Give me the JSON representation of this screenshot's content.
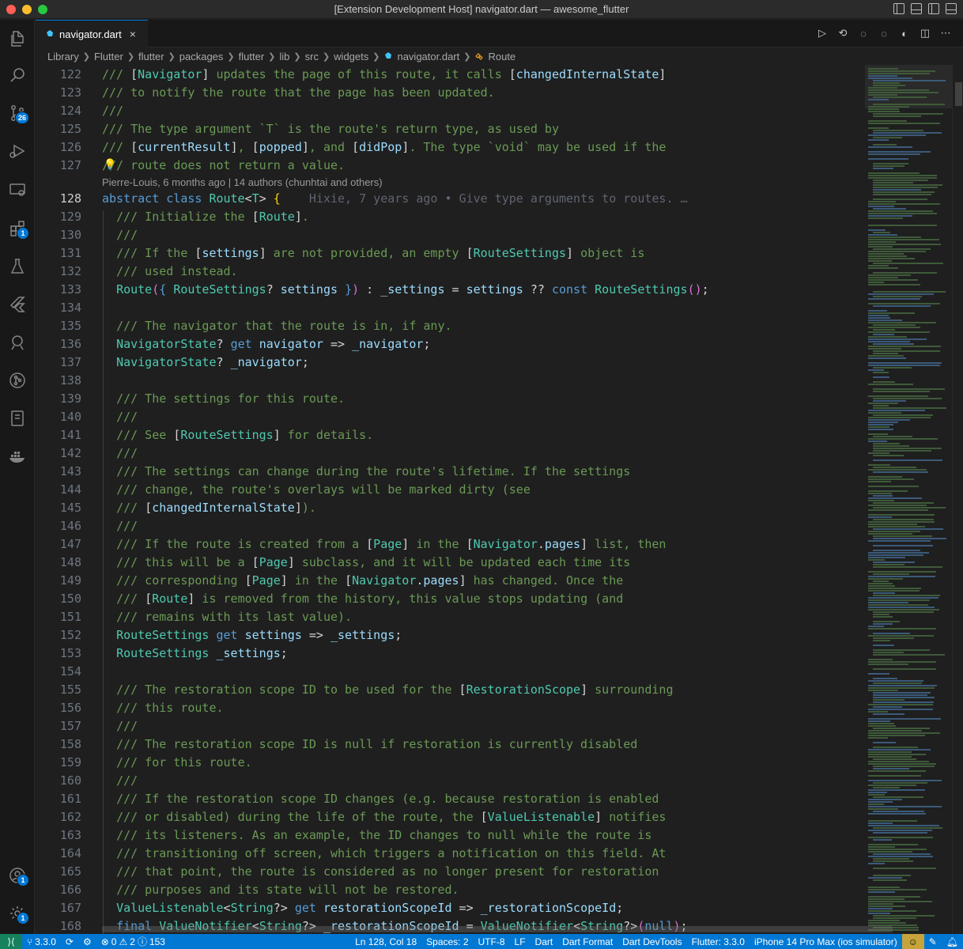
{
  "window": {
    "title": "[Extension Development Host] navigator.dart — awesome_flutter"
  },
  "activity_bar": {
    "source_control_badge": "26",
    "extensions_badge": "1",
    "accounts_badge": "1",
    "settings_badge": "1"
  },
  "tabs": [
    {
      "label": "navigator.dart",
      "close": "×"
    }
  ],
  "breadcrumbs": [
    "Library",
    "Flutter",
    "flutter",
    "packages",
    "flutter",
    "lib",
    "src",
    "widgets",
    "navigator.dart",
    "Route"
  ],
  "editor": {
    "codelens": "Pierre-Louis, 6 months ago | 14 authors (chunhtai and others)",
    "blame": "Hixie, 7 years ago • Give type arguments to routes. …",
    "line_numbers": [
      "122",
      "123",
      "124",
      "125",
      "126",
      "127",
      "128",
      "129",
      "130",
      "131",
      "132",
      "133",
      "134",
      "135",
      "136",
      "137",
      "138",
      "139",
      "140",
      "141",
      "142",
      "143",
      "144",
      "145",
      "146",
      "147",
      "148",
      "149",
      "150",
      "151",
      "152",
      "153",
      "154",
      "155",
      "156",
      "157",
      "158",
      "159",
      "160",
      "161",
      "162",
      "163",
      "164",
      "165",
      "166",
      "167",
      "168"
    ],
    "active_line": "128",
    "lines": [
      [
        [
          "c-cm",
          "/// "
        ],
        [
          "c-pun",
          "["
        ],
        [
          "c-ref",
          "Navigator"
        ],
        [
          "c-pun",
          "]"
        ],
        [
          "c-cm",
          " updates the page of this route, it calls "
        ],
        [
          "c-pun",
          "["
        ],
        [
          "c-refv",
          "changedInternalState"
        ],
        [
          "c-pun",
          "]"
        ]
      ],
      [
        [
          "c-cm",
          "/// to notify the route that the page has been updated."
        ]
      ],
      [
        [
          "c-cm",
          "///"
        ]
      ],
      [
        [
          "c-cm",
          "/// The type argument `T` is the route's return type, as used by"
        ]
      ],
      [
        [
          "c-cm",
          "/// "
        ],
        [
          "c-pun",
          "["
        ],
        [
          "c-refv",
          "currentResult"
        ],
        [
          "c-pun",
          "]"
        ],
        [
          "c-cm",
          ", "
        ],
        [
          "c-pun",
          "["
        ],
        [
          "c-refv",
          "popped"
        ],
        [
          "c-pun",
          "]"
        ],
        [
          "c-cm",
          ", and "
        ],
        [
          "c-pun",
          "["
        ],
        [
          "c-refv",
          "didPop"
        ],
        [
          "c-pun",
          "]"
        ],
        [
          "c-cm",
          ". The type `void` may be used if the"
        ]
      ],
      [
        [
          "c-cm",
          "/// route does not return a value."
        ]
      ],
      [
        [
          "c-kw",
          "abstract"
        ],
        [
          "c-code",
          " "
        ],
        [
          "c-kw",
          "class"
        ],
        [
          "c-code",
          " "
        ],
        [
          "c-ty",
          "Route"
        ],
        [
          "c-pun",
          "<"
        ],
        [
          "c-ty",
          "T"
        ],
        [
          "c-pun",
          "> "
        ],
        [
          "c-br",
          "{"
        ]
      ],
      [
        [
          "c-code",
          "  "
        ],
        [
          "c-cm",
          "/// Initialize the "
        ],
        [
          "c-pun",
          "["
        ],
        [
          "c-ref",
          "Route"
        ],
        [
          "c-pun",
          "]"
        ],
        [
          "c-cm",
          "."
        ]
      ],
      [
        [
          "c-code",
          "  "
        ],
        [
          "c-cm",
          "///"
        ]
      ],
      [
        [
          "c-code",
          "  "
        ],
        [
          "c-cm",
          "/// If the "
        ],
        [
          "c-pun",
          "["
        ],
        [
          "c-refv",
          "settings"
        ],
        [
          "c-pun",
          "]"
        ],
        [
          "c-cm",
          " are not provided, an empty "
        ],
        [
          "c-pun",
          "["
        ],
        [
          "c-ref",
          "RouteSettings"
        ],
        [
          "c-pun",
          "]"
        ],
        [
          "c-cm",
          " object is"
        ]
      ],
      [
        [
          "c-code",
          "  "
        ],
        [
          "c-cm",
          "/// used instead."
        ]
      ],
      [
        [
          "c-code",
          "  "
        ],
        [
          "c-ty",
          "Route"
        ],
        [
          "c-br2",
          "("
        ],
        [
          "c-kw",
          "{"
        ],
        [
          "c-code",
          " "
        ],
        [
          "c-ty",
          "RouteSettings"
        ],
        [
          "c-pun",
          "? "
        ],
        [
          "c-var",
          "settings"
        ],
        [
          "c-code",
          " "
        ],
        [
          "c-kw",
          "}"
        ],
        [
          "c-br2",
          ")"
        ],
        [
          "c-pun",
          " : "
        ],
        [
          "c-var",
          "_settings"
        ],
        [
          "c-pun",
          " = "
        ],
        [
          "c-var",
          "settings"
        ],
        [
          "c-pun",
          " ?? "
        ],
        [
          "c-kw",
          "const"
        ],
        [
          "c-code",
          " "
        ],
        [
          "c-ty",
          "RouteSettings"
        ],
        [
          "c-br2",
          "()"
        ],
        [
          "c-pun",
          ";"
        ]
      ],
      [
        [
          "c-code",
          ""
        ]
      ],
      [
        [
          "c-code",
          "  "
        ],
        [
          "c-cm",
          "/// The navigator that the route is in, if any."
        ]
      ],
      [
        [
          "c-code",
          "  "
        ],
        [
          "c-ty",
          "NavigatorState"
        ],
        [
          "c-pun",
          "? "
        ],
        [
          "c-kw",
          "get"
        ],
        [
          "c-code",
          " "
        ],
        [
          "c-var",
          "navigator"
        ],
        [
          "c-pun",
          " => "
        ],
        [
          "c-var",
          "_navigator"
        ],
        [
          "c-pun",
          ";"
        ]
      ],
      [
        [
          "c-code",
          "  "
        ],
        [
          "c-ty",
          "NavigatorState"
        ],
        [
          "c-pun",
          "? "
        ],
        [
          "c-var",
          "_navigator"
        ],
        [
          "c-pun",
          ";"
        ]
      ],
      [
        [
          "c-code",
          ""
        ]
      ],
      [
        [
          "c-code",
          "  "
        ],
        [
          "c-cm",
          "/// The settings for this route."
        ]
      ],
      [
        [
          "c-code",
          "  "
        ],
        [
          "c-cm",
          "///"
        ]
      ],
      [
        [
          "c-code",
          "  "
        ],
        [
          "c-cm",
          "/// See "
        ],
        [
          "c-pun",
          "["
        ],
        [
          "c-ref",
          "RouteSettings"
        ],
        [
          "c-pun",
          "]"
        ],
        [
          "c-cm",
          " for details."
        ]
      ],
      [
        [
          "c-code",
          "  "
        ],
        [
          "c-cm",
          "///"
        ]
      ],
      [
        [
          "c-code",
          "  "
        ],
        [
          "c-cm",
          "/// The settings can change during the route's lifetime. If the settings"
        ]
      ],
      [
        [
          "c-code",
          "  "
        ],
        [
          "c-cm",
          "/// change, the route's overlays will be marked dirty (see"
        ]
      ],
      [
        [
          "c-code",
          "  "
        ],
        [
          "c-cm",
          "/// "
        ],
        [
          "c-pun",
          "["
        ],
        [
          "c-refv",
          "changedInternalState"
        ],
        [
          "c-pun",
          "]"
        ],
        [
          "c-cm",
          ")."
        ]
      ],
      [
        [
          "c-code",
          "  "
        ],
        [
          "c-cm",
          "///"
        ]
      ],
      [
        [
          "c-code",
          "  "
        ],
        [
          "c-cm",
          "/// If the route is created from a "
        ],
        [
          "c-pun",
          "["
        ],
        [
          "c-ref",
          "Page"
        ],
        [
          "c-pun",
          "]"
        ],
        [
          "c-cm",
          " in the "
        ],
        [
          "c-pun",
          "["
        ],
        [
          "c-ref",
          "Navigator"
        ],
        [
          "c-pun",
          "."
        ],
        [
          "c-refv",
          "pages"
        ],
        [
          "c-pun",
          "]"
        ],
        [
          "c-cm",
          " list, then"
        ]
      ],
      [
        [
          "c-code",
          "  "
        ],
        [
          "c-cm",
          "/// this will be a "
        ],
        [
          "c-pun",
          "["
        ],
        [
          "c-ref",
          "Page"
        ],
        [
          "c-pun",
          "]"
        ],
        [
          "c-cm",
          " subclass, and it will be updated each time its"
        ]
      ],
      [
        [
          "c-code",
          "  "
        ],
        [
          "c-cm",
          "/// corresponding "
        ],
        [
          "c-pun",
          "["
        ],
        [
          "c-ref",
          "Page"
        ],
        [
          "c-pun",
          "]"
        ],
        [
          "c-cm",
          " in the "
        ],
        [
          "c-pun",
          "["
        ],
        [
          "c-ref",
          "Navigator"
        ],
        [
          "c-pun",
          "."
        ],
        [
          "c-refv",
          "pages"
        ],
        [
          "c-pun",
          "]"
        ],
        [
          "c-cm",
          " has changed. Once the"
        ]
      ],
      [
        [
          "c-code",
          "  "
        ],
        [
          "c-cm",
          "/// "
        ],
        [
          "c-pun",
          "["
        ],
        [
          "c-ref",
          "Route"
        ],
        [
          "c-pun",
          "]"
        ],
        [
          "c-cm",
          " is removed from the history, this value stops updating (and"
        ]
      ],
      [
        [
          "c-code",
          "  "
        ],
        [
          "c-cm",
          "/// remains with its last value)."
        ]
      ],
      [
        [
          "c-code",
          "  "
        ],
        [
          "c-ty",
          "RouteSettings"
        ],
        [
          "c-code",
          " "
        ],
        [
          "c-kw",
          "get"
        ],
        [
          "c-code",
          " "
        ],
        [
          "c-var",
          "settings"
        ],
        [
          "c-pun",
          " => "
        ],
        [
          "c-var",
          "_settings"
        ],
        [
          "c-pun",
          ";"
        ]
      ],
      [
        [
          "c-code",
          "  "
        ],
        [
          "c-ty",
          "RouteSettings"
        ],
        [
          "c-code",
          " "
        ],
        [
          "c-var",
          "_settings"
        ],
        [
          "c-pun",
          ";"
        ]
      ],
      [
        [
          "c-code",
          ""
        ]
      ],
      [
        [
          "c-code",
          "  "
        ],
        [
          "c-cm",
          "/// The restoration scope ID to be used for the "
        ],
        [
          "c-pun",
          "["
        ],
        [
          "c-ref",
          "RestorationScope"
        ],
        [
          "c-pun",
          "]"
        ],
        [
          "c-cm",
          " surrounding"
        ]
      ],
      [
        [
          "c-code",
          "  "
        ],
        [
          "c-cm",
          "/// this route."
        ]
      ],
      [
        [
          "c-code",
          "  "
        ],
        [
          "c-cm",
          "///"
        ]
      ],
      [
        [
          "c-code",
          "  "
        ],
        [
          "c-cm",
          "/// The restoration scope ID is null if restoration is currently disabled"
        ]
      ],
      [
        [
          "c-code",
          "  "
        ],
        [
          "c-cm",
          "/// for this route."
        ]
      ],
      [
        [
          "c-code",
          "  "
        ],
        [
          "c-cm",
          "///"
        ]
      ],
      [
        [
          "c-code",
          "  "
        ],
        [
          "c-cm",
          "/// If the restoration scope ID changes (e.g. because restoration is enabled"
        ]
      ],
      [
        [
          "c-code",
          "  "
        ],
        [
          "c-cm",
          "/// or disabled) during the life of the route, the "
        ],
        [
          "c-pun",
          "["
        ],
        [
          "c-ref",
          "ValueListenable"
        ],
        [
          "c-pun",
          "]"
        ],
        [
          "c-cm",
          " notifies"
        ]
      ],
      [
        [
          "c-code",
          "  "
        ],
        [
          "c-cm",
          "/// its listeners. As an example, the ID changes to null while the route is"
        ]
      ],
      [
        [
          "c-code",
          "  "
        ],
        [
          "c-cm",
          "/// transitioning off screen, which triggers a notification on this field. At"
        ]
      ],
      [
        [
          "c-code",
          "  "
        ],
        [
          "c-cm",
          "/// that point, the route is considered as no longer present for restoration"
        ]
      ],
      [
        [
          "c-code",
          "  "
        ],
        [
          "c-cm",
          "/// purposes and its state will not be restored."
        ]
      ],
      [
        [
          "c-code",
          "  "
        ],
        [
          "c-ty",
          "ValueListenable"
        ],
        [
          "c-pun",
          "<"
        ],
        [
          "c-ty",
          "String"
        ],
        [
          "c-pun",
          "?> "
        ],
        [
          "c-kw",
          "get"
        ],
        [
          "c-code",
          " "
        ],
        [
          "c-var",
          "restorationScopeId"
        ],
        [
          "c-pun",
          " => "
        ],
        [
          "c-var",
          "_restorationScopeId"
        ],
        [
          "c-pun",
          ";"
        ]
      ],
      [
        [
          "c-code",
          "  "
        ],
        [
          "c-kw",
          "final"
        ],
        [
          "c-code",
          " "
        ],
        [
          "c-ty",
          "ValueNotifier"
        ],
        [
          "c-pun",
          "<"
        ],
        [
          "c-ty",
          "String"
        ],
        [
          "c-pun",
          "?> "
        ],
        [
          "c-var",
          "_restorationScopeId"
        ],
        [
          "c-pun",
          " = "
        ],
        [
          "c-ty",
          "ValueNotifier"
        ],
        [
          "c-pun",
          "<"
        ],
        [
          "c-ty",
          "String"
        ],
        [
          "c-pun",
          "?>"
        ],
        [
          "c-br2",
          "("
        ],
        [
          "c-kw",
          "null"
        ],
        [
          "c-br2",
          ")"
        ],
        [
          "c-pun",
          ";"
        ]
      ]
    ]
  },
  "statusbar": {
    "version": "3.3.0",
    "errors": "0",
    "warnings": "2",
    "info": "153",
    "position": "Ln 128, Col 18",
    "spaces": "Spaces: 2",
    "encoding": "UTF-8",
    "eol": "LF",
    "language": "Dart",
    "format": "Dart Format",
    "devtools": "Dart DevTools",
    "flutter": "Flutter: 3.3.0",
    "device": "iPhone 14 Pro Max (ios simulator)"
  }
}
